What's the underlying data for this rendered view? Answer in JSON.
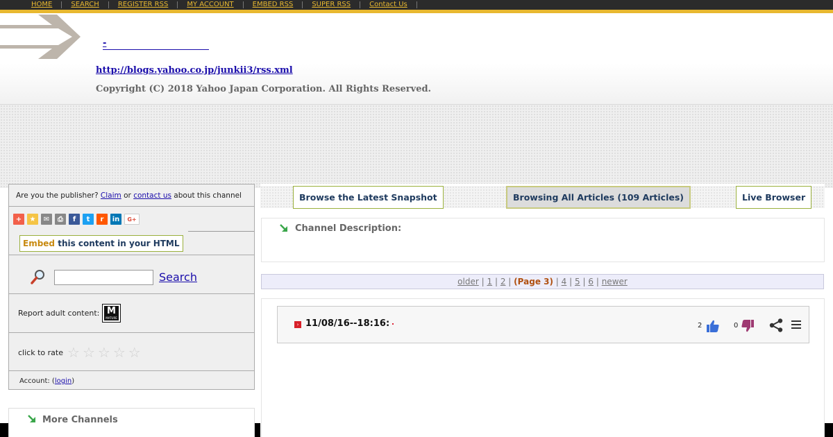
{
  "nav": {
    "items": [
      {
        "label": "HOME"
      },
      {
        "label": "SEARCH"
      },
      {
        "label": "REGISTER RSS"
      },
      {
        "label": "MY ACCOUNT"
      },
      {
        "label": "EMBED RSS"
      },
      {
        "label": "SUPER RSS"
      },
      {
        "label": "Contact Us"
      }
    ]
  },
  "header": {
    "channel_title": "-",
    "rss_url": "http://blogs.yahoo.co.jp/junkii3/rss.xml",
    "copyright": "Copyright (C) 2018 Yahoo Japan Corporation. All Rights Reserved."
  },
  "sidebar": {
    "publisher_prefix": "Are you the publisher?",
    "claim_label": "Claim",
    "or_text": "or",
    "contact_label": "contact us",
    "publisher_suffix": "about this channel",
    "share_icons": [
      "addthis-icon",
      "favorites-icon",
      "email-icon",
      "print-icon",
      "facebook-icon",
      "twitter-icon",
      "reddit-icon",
      "linkedin-icon",
      "google-plus-icon"
    ],
    "embed_word": "Embed",
    "embed_rest": "this content in your HTML",
    "search_label": "Search",
    "adult_label": "Report adult content:",
    "mature_letter": "M",
    "mature_small": "MATURE",
    "rate_label": "click to rate",
    "account_prefix": "Account: (",
    "login_label": "login",
    "account_suffix": ")"
  },
  "more_channels": {
    "title": "More Channels"
  },
  "tabs": {
    "snapshot": "Browse the Latest Snapshot",
    "all": "Browsing All Articles (109 Articles)",
    "live": "Live Browser"
  },
  "description": {
    "title": "Channel Description:"
  },
  "pager": {
    "older": "older",
    "pages": [
      "1",
      "2"
    ],
    "current": "(Page 3)",
    "pages_after": [
      "4",
      "5",
      "6"
    ],
    "newer": "newer",
    "sep": "|"
  },
  "article": {
    "title": "11/08/16--18:16:",
    "up_votes": "2",
    "down_votes": "0"
  },
  "colors": {
    "nav_bg": "#2b2b2b",
    "nav_gold": "#e8b830",
    "tab_border": "#9ab03c",
    "pager_current": "#b05010"
  }
}
